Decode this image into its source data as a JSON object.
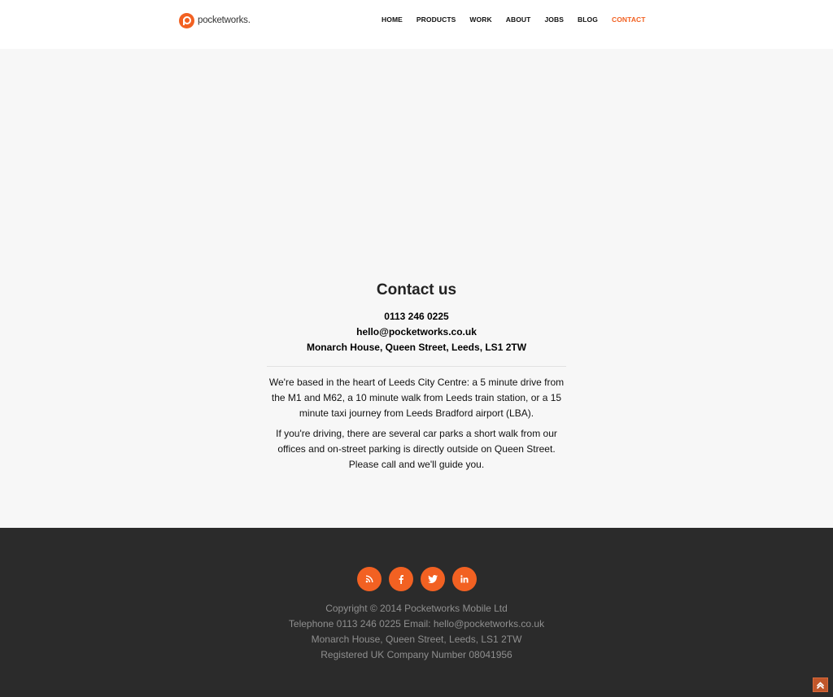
{
  "brand": {
    "name": "pocketworks."
  },
  "nav": {
    "items": [
      {
        "label": "HOME"
      },
      {
        "label": "PRODUCTS"
      },
      {
        "label": "WORK"
      },
      {
        "label": "ABOUT"
      },
      {
        "label": "JOBS"
      },
      {
        "label": "BLOG"
      },
      {
        "label": "CONTACT"
      }
    ],
    "active": "CONTACT"
  },
  "contact": {
    "title": "Contact us",
    "phone": "0113 246 0225",
    "email": "hello@pocketworks.co.uk",
    "address": "Monarch House, Queen Street, Leeds, LS1 2TW",
    "paragraph1": "We're based in the heart of Leeds City Centre: a 5 minute drive from the M1 and M62, a 10 minute walk from Leeds train station, or a 15 minute taxi journey from Leeds Bradford airport (LBA).",
    "paragraph2": "If you're driving, there are several car parks a short walk from our offices and on-street parking is directly outside on Queen Street. Please call and we'll guide you."
  },
  "footer": {
    "social": [
      {
        "icon": "rss-icon"
      },
      {
        "icon": "facebook-icon"
      },
      {
        "icon": "twitter-icon"
      },
      {
        "icon": "linkedin-icon"
      }
    ],
    "copyright": "Copyright © 2014 Pocketworks Mobile Ltd",
    "telephone_line": "Telephone 0113 246 0225 Email: hello@pocketworks.co.uk",
    "address": "Monarch House, Queen Street, Leeds, LS1 2TW",
    "company": "Registered UK Company Number 08041956"
  },
  "colors": {
    "accent": "#f26122",
    "footer_bg": "#2b2b2b",
    "page_bg": "#f7f7f7"
  }
}
